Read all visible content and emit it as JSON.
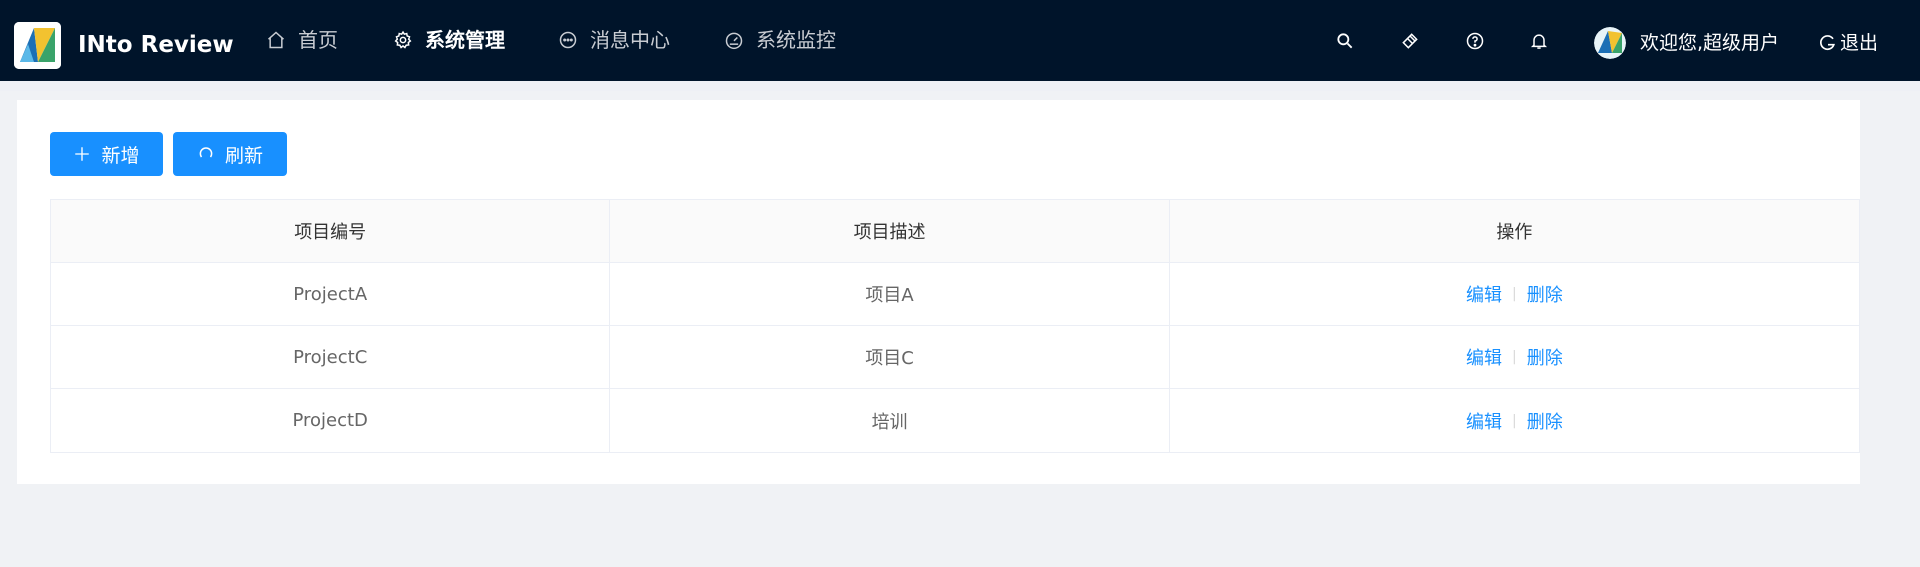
{
  "app": {
    "title": "INto Review"
  },
  "nav": [
    {
      "label": "首页",
      "icon": "home-icon",
      "active": false
    },
    {
      "label": "系统管理",
      "icon": "gear-icon",
      "active": true
    },
    {
      "label": "消息中心",
      "icon": "chat-icon",
      "active": false
    },
    {
      "label": "系统监控",
      "icon": "dashboard-icon",
      "active": false
    }
  ],
  "header_actions": {
    "welcome": "欢迎您,超级用户",
    "logout": "退出"
  },
  "toolbar": {
    "add_label": "新增",
    "refresh_label": "刷新"
  },
  "table": {
    "columns": [
      "项目编号",
      "项目描述",
      "操作"
    ],
    "rows": [
      {
        "code": "ProjectA",
        "desc": "项目A"
      },
      {
        "code": "ProjectC",
        "desc": "项目C"
      },
      {
        "code": "ProjectD",
        "desc": "培训"
      }
    ],
    "edit_label": "编辑",
    "delete_label": "删除",
    "separator": "|"
  },
  "colors": {
    "header_bg": "#00142a",
    "primary": "#1890ff",
    "page_bg": "#f0f2f5"
  }
}
